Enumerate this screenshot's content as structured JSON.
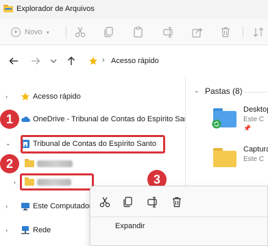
{
  "window": {
    "title": "Explorador de Arquivos"
  },
  "toolbar": {
    "new_label": "Novo"
  },
  "address": {
    "path": "Acesso rápido"
  },
  "sidebar": {
    "items": [
      {
        "label": "Acesso rápido"
      },
      {
        "label": "OneDrive - Tribunal de Contas do Espírito Santo"
      },
      {
        "label": "Tribunal de Contas do Espírito Santo"
      },
      {
        "label": ""
      },
      {
        "label": ""
      },
      {
        "label": "Este Computador"
      },
      {
        "label": "Rede"
      }
    ]
  },
  "content": {
    "group_header": "Pastas (8)",
    "files": [
      {
        "name": "Desktop",
        "sub": "Este C"
      },
      {
        "name": "Captura",
        "sub": "Este C"
      }
    ]
  },
  "annotations": {
    "badge1": "1",
    "badge2": "2",
    "badge3": "3"
  },
  "context_menu": {
    "expand_label": "Expandir"
  },
  "colors": {
    "highlight": "#d9333a",
    "folder": "#f2c448",
    "accent": "#2e7fd1"
  }
}
